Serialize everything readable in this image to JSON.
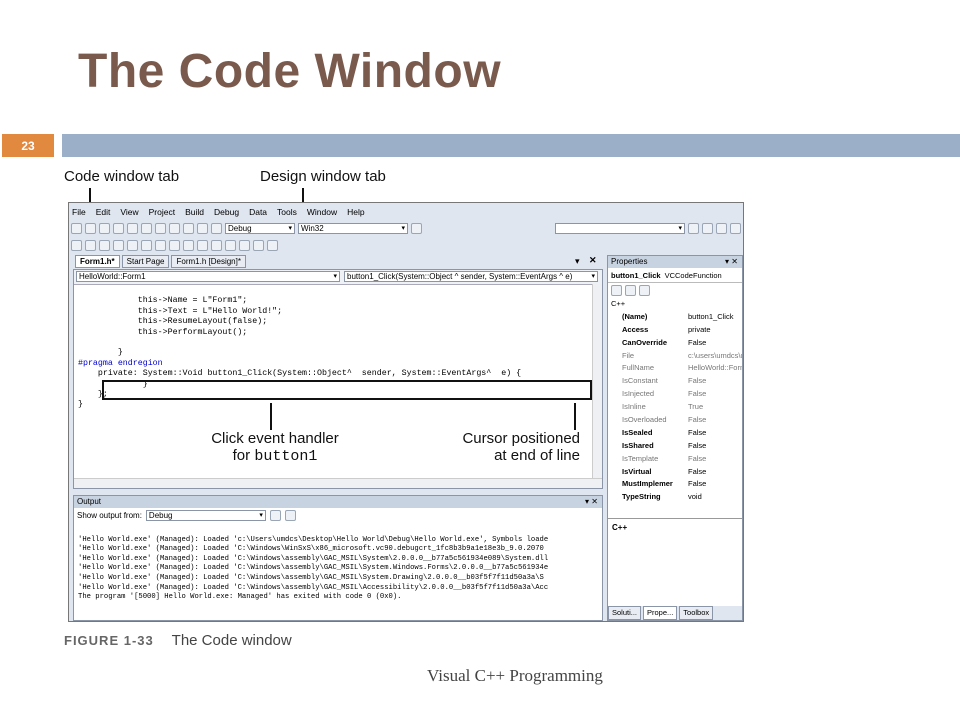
{
  "slide": {
    "title": "The Code Window",
    "number": "23",
    "footer": "Visual C++ Programming"
  },
  "figure": {
    "label": "FIGURE 1-33",
    "caption": "The Code window",
    "callouts": {
      "code_tab": "Code window tab",
      "design_tab": "Design window tab",
      "click_line1": "Click event handler",
      "click_line2_prefix": "for",
      "click_line2_code": "button1",
      "cursor_line1": "Cursor positioned",
      "cursor_line2": "at end of line"
    }
  },
  "ide": {
    "menu": [
      "File",
      "Edit",
      "View",
      "Project",
      "Build",
      "Debug",
      "Data",
      "Tools",
      "Window",
      "Help"
    ],
    "toolbar": {
      "config": "Debug",
      "platform": "Win32"
    },
    "tabs": [
      "Form1.h*",
      "Start Page",
      "Form1.h [Design]*"
    ],
    "editor": {
      "class_combo": "HelloWorld::Form1",
      "member_combo": "button1_Click(System::Object ^ sender, System::EventArgs ^ e)",
      "lines": [
        "            this->Name = L\"Form1\";",
        "            this->Text = L\"Hello World!\";",
        "            this->ResumeLayout(false);",
        "            this->PerformLayout();",
        "",
        "        }",
        "#pragma endregion",
        "    private: System::Void button1_Click(System::Object^  sender, System::EventArgs^  e) {",
        "             }",
        "    };",
        "}"
      ]
    },
    "output": {
      "title": "Output",
      "show_from_label": "Show output from:",
      "show_from_value": "Debug",
      "lines": [
        "'Hello World.exe' (Managed): Loaded 'c:\\Users\\umdcs\\Desktop\\Hello World\\Debug\\Hello World.exe', Symbols loade",
        "'Hello World.exe' (Managed): Loaded 'C:\\Windows\\WinSxS\\x86_microsoft.vc90.debugcrt_1fc8b3b9a1e18e3b_9.0.2070",
        "'Hello World.exe' (Managed): Loaded 'C:\\Windows\\assembly\\GAC_MSIL\\System\\2.0.0.0__b77a5c561934e089\\System.dll",
        "'Hello World.exe' (Managed): Loaded 'C:\\Windows\\assembly\\GAC_MSIL\\System.Windows.Forms\\2.0.0.0__b77a5c561934e",
        "'Hello World.exe' (Managed): Loaded 'C:\\Windows\\assembly\\GAC_MSIL\\System.Drawing\\2.0.0.0__b03f5f7f11d50a3a\\S",
        "'Hello World.exe' (Managed): Loaded 'C:\\Windows\\assembly\\GAC_MSIL\\Accessibility\\2.0.0.0__b03f5f7f11d50a3a\\Acc",
        "The program '[5000] Hello World.exe: Managed' has exited with code 0 (0x0)."
      ]
    },
    "properties": {
      "title": "Properties",
      "object": "button1_Click",
      "object_type": "VCCodeFunction",
      "category": "C++",
      "rows": [
        {
          "key": "(Name)",
          "value": "button1_Click",
          "bold": true
        },
        {
          "key": "Access",
          "value": "private",
          "bold": true
        },
        {
          "key": "CanOverride",
          "value": "False",
          "bold": true
        },
        {
          "key": "File",
          "value": "c:\\users\\umdcs\\de",
          "bold": false
        },
        {
          "key": "FullName",
          "value": "HelloWorld::Form1",
          "bold": false
        },
        {
          "key": "IsConstant",
          "value": "False",
          "bold": false
        },
        {
          "key": "IsInjected",
          "value": "False",
          "bold": false
        },
        {
          "key": "IsInline",
          "value": "True",
          "bold": false
        },
        {
          "key": "IsOverloaded",
          "value": "False",
          "bold": false
        },
        {
          "key": "IsSealed",
          "value": "False",
          "bold": true
        },
        {
          "key": "IsShared",
          "value": "False",
          "bold": true
        },
        {
          "key": "IsTemplate",
          "value": "False",
          "bold": false
        },
        {
          "key": "IsVirtual",
          "value": "False",
          "bold": true
        },
        {
          "key": "MustImplemer",
          "value": "False",
          "bold": true
        },
        {
          "key": "TypeString",
          "value": "void",
          "bold": true
        }
      ],
      "description": "C++",
      "bottom_tabs": [
        "Soluti...",
        "Prope...",
        "Toolbox"
      ]
    }
  }
}
